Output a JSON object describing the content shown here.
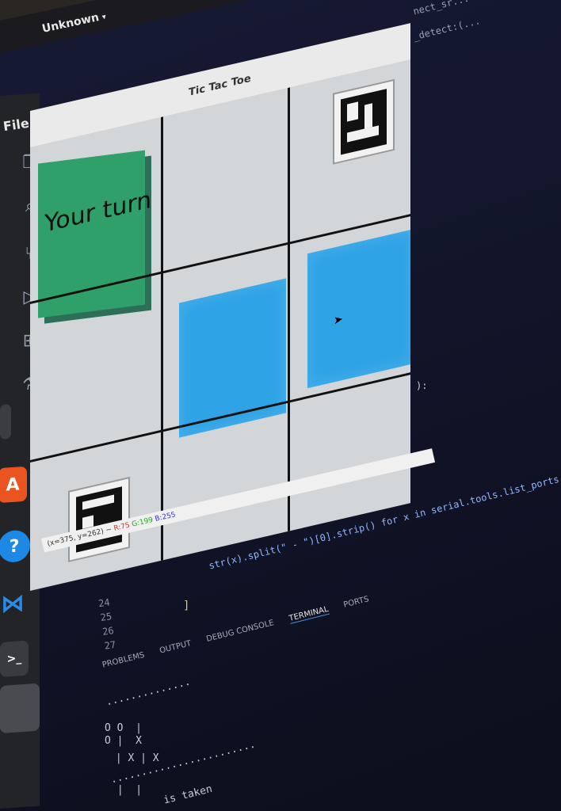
{
  "topbar": {
    "network_label": "Unknown"
  },
  "window": {
    "title": "Tic Tac Toe"
  },
  "menu": {
    "file": "File"
  },
  "game": {
    "status_text": "Your turn"
  },
  "pixel_readout": {
    "coords": "(x=375, y=262) ~",
    "r": "R:75",
    "g": "G:199",
    "b": "B:255"
  },
  "code": {
    "top_right": "nect_sr...",
    "top_right2": "_detect:(...",
    "split_line": "str(x).split(\" - \")[0].strip() for x in serial.tools.list_ports",
    "mid_line": "):",
    "bracket": "]"
  },
  "editor": {
    "line_numbers": [
      "24",
      "25",
      "26",
      "27"
    ]
  },
  "panel": {
    "tabs": [
      "PROBLEMS",
      "OUTPUT",
      "DEBUG CONSOLE",
      "TERMINAL",
      "PORTS"
    ],
    "active_tab": "TERMINAL"
  },
  "terminal": {
    "dots1": "..............",
    "board_row1": "O O  |",
    "board_row2": "O |  X",
    "board_row3": " | X | X",
    "dots2": "........................",
    "board_row4": " |  |",
    "taken_text": "is taken"
  },
  "colors": {
    "green_piece": "#2fa06a",
    "blue_cube": "#2ea3e6",
    "terminal_bg": "#12152a"
  }
}
